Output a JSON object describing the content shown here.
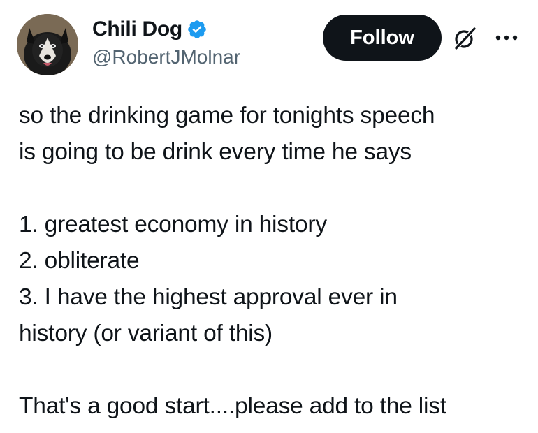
{
  "author": {
    "display_name": "Chili Dog",
    "handle": "@RobertJMolnar",
    "verified": true,
    "avatar_icon": "dog-avatar",
    "verified_icon": "verified-badge-icon"
  },
  "actions": {
    "follow_label": "Follow",
    "grok_icon": "grok-icon",
    "more_icon": "more-options-icon"
  },
  "tweet": {
    "text": "so the drinking game for tonights speech\nis going to be drink every time he says\n\n1. greatest economy in history\n2. obliterate\n3. I have the highest approval ever in\nhistory (or variant of this)\n\nThat's a good start....please add to the list"
  },
  "colors": {
    "text_primary": "#0f1419",
    "text_secondary": "#536471",
    "verified_blue": "#1d9bf0",
    "follow_bg": "#0f1419"
  }
}
